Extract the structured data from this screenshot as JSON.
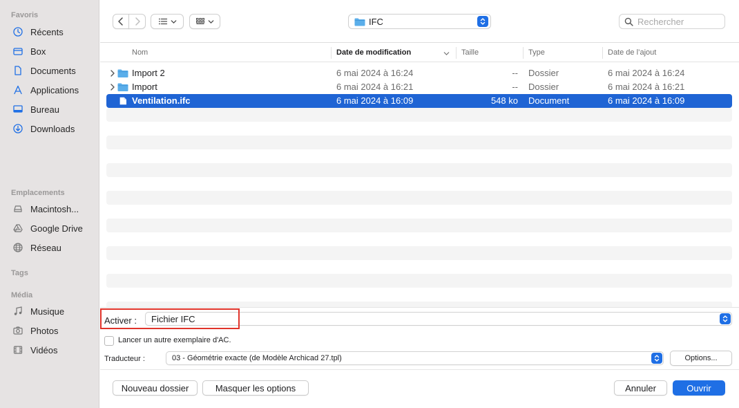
{
  "sidebar": {
    "sections": [
      {
        "title": "Favoris"
      },
      {
        "title": "Emplacements"
      },
      {
        "title": "Tags"
      },
      {
        "title": "Média"
      }
    ],
    "favoris": [
      {
        "label": "Récents",
        "icon": "clock-icon"
      },
      {
        "label": "Box",
        "icon": "box-icon"
      },
      {
        "label": "Documents",
        "icon": "document-icon"
      },
      {
        "label": "Applications",
        "icon": "applications-icon"
      },
      {
        "label": "Bureau",
        "icon": "desktop-icon"
      },
      {
        "label": "Downloads",
        "icon": "download-icon"
      }
    ],
    "emplacements": [
      {
        "label": "Macintosh...",
        "icon": "hard-drive-icon"
      },
      {
        "label": "Google Drive",
        "icon": "google-drive-icon"
      },
      {
        "label": "Réseau",
        "icon": "network-icon"
      }
    ],
    "media": [
      {
        "label": "Musique",
        "icon": "music-note-icon"
      },
      {
        "label": "Photos",
        "icon": "camera-icon"
      },
      {
        "label": "Vidéos",
        "icon": "film-icon"
      }
    ]
  },
  "toolbar": {
    "current_folder": "IFC",
    "search_placeholder": "Rechercher"
  },
  "columns": {
    "name": "Nom",
    "modified": "Date de modification",
    "size": "Taille",
    "type": "Type",
    "added": "Date de l’ajout"
  },
  "files": [
    {
      "name": "Import 2",
      "modified": "6 mai 2024 à 16:24",
      "size": "--",
      "type": "Dossier",
      "added": "6 mai 2024 à 16:24",
      "kind": "folder"
    },
    {
      "name": "Import",
      "modified": "6 mai 2024 à 16:21",
      "size": "--",
      "type": "Dossier",
      "added": "6 mai 2024 à 16:21",
      "kind": "folder"
    },
    {
      "name": "Ventilation.ifc",
      "modified": "6 mai 2024 à 16:09",
      "size": "548 ko",
      "type": "Document",
      "added": "6 mai 2024 à 16:09",
      "kind": "document",
      "selected": true
    }
  ],
  "options": {
    "activer_label": "Activer :",
    "activer_value": "Fichier IFC",
    "checkbox_label": "Lancer un autre exemplaire d'AC.",
    "checkbox_checked": false,
    "traducteur_label": "Traducteur :",
    "traducteur_value": "03 - Géométrie exacte (de Modèle Archicad 27.tpl)",
    "options_button": "Options..."
  },
  "buttons": {
    "new_folder": "Nouveau dossier",
    "hide_options": "Masquer les options",
    "cancel": "Annuler",
    "open": "Ouvrir"
  },
  "colors": {
    "accent": "#1f6fe5",
    "selection": "#1f64d4",
    "highlight_box": "#e0332a",
    "folder": "#5aaeea"
  }
}
